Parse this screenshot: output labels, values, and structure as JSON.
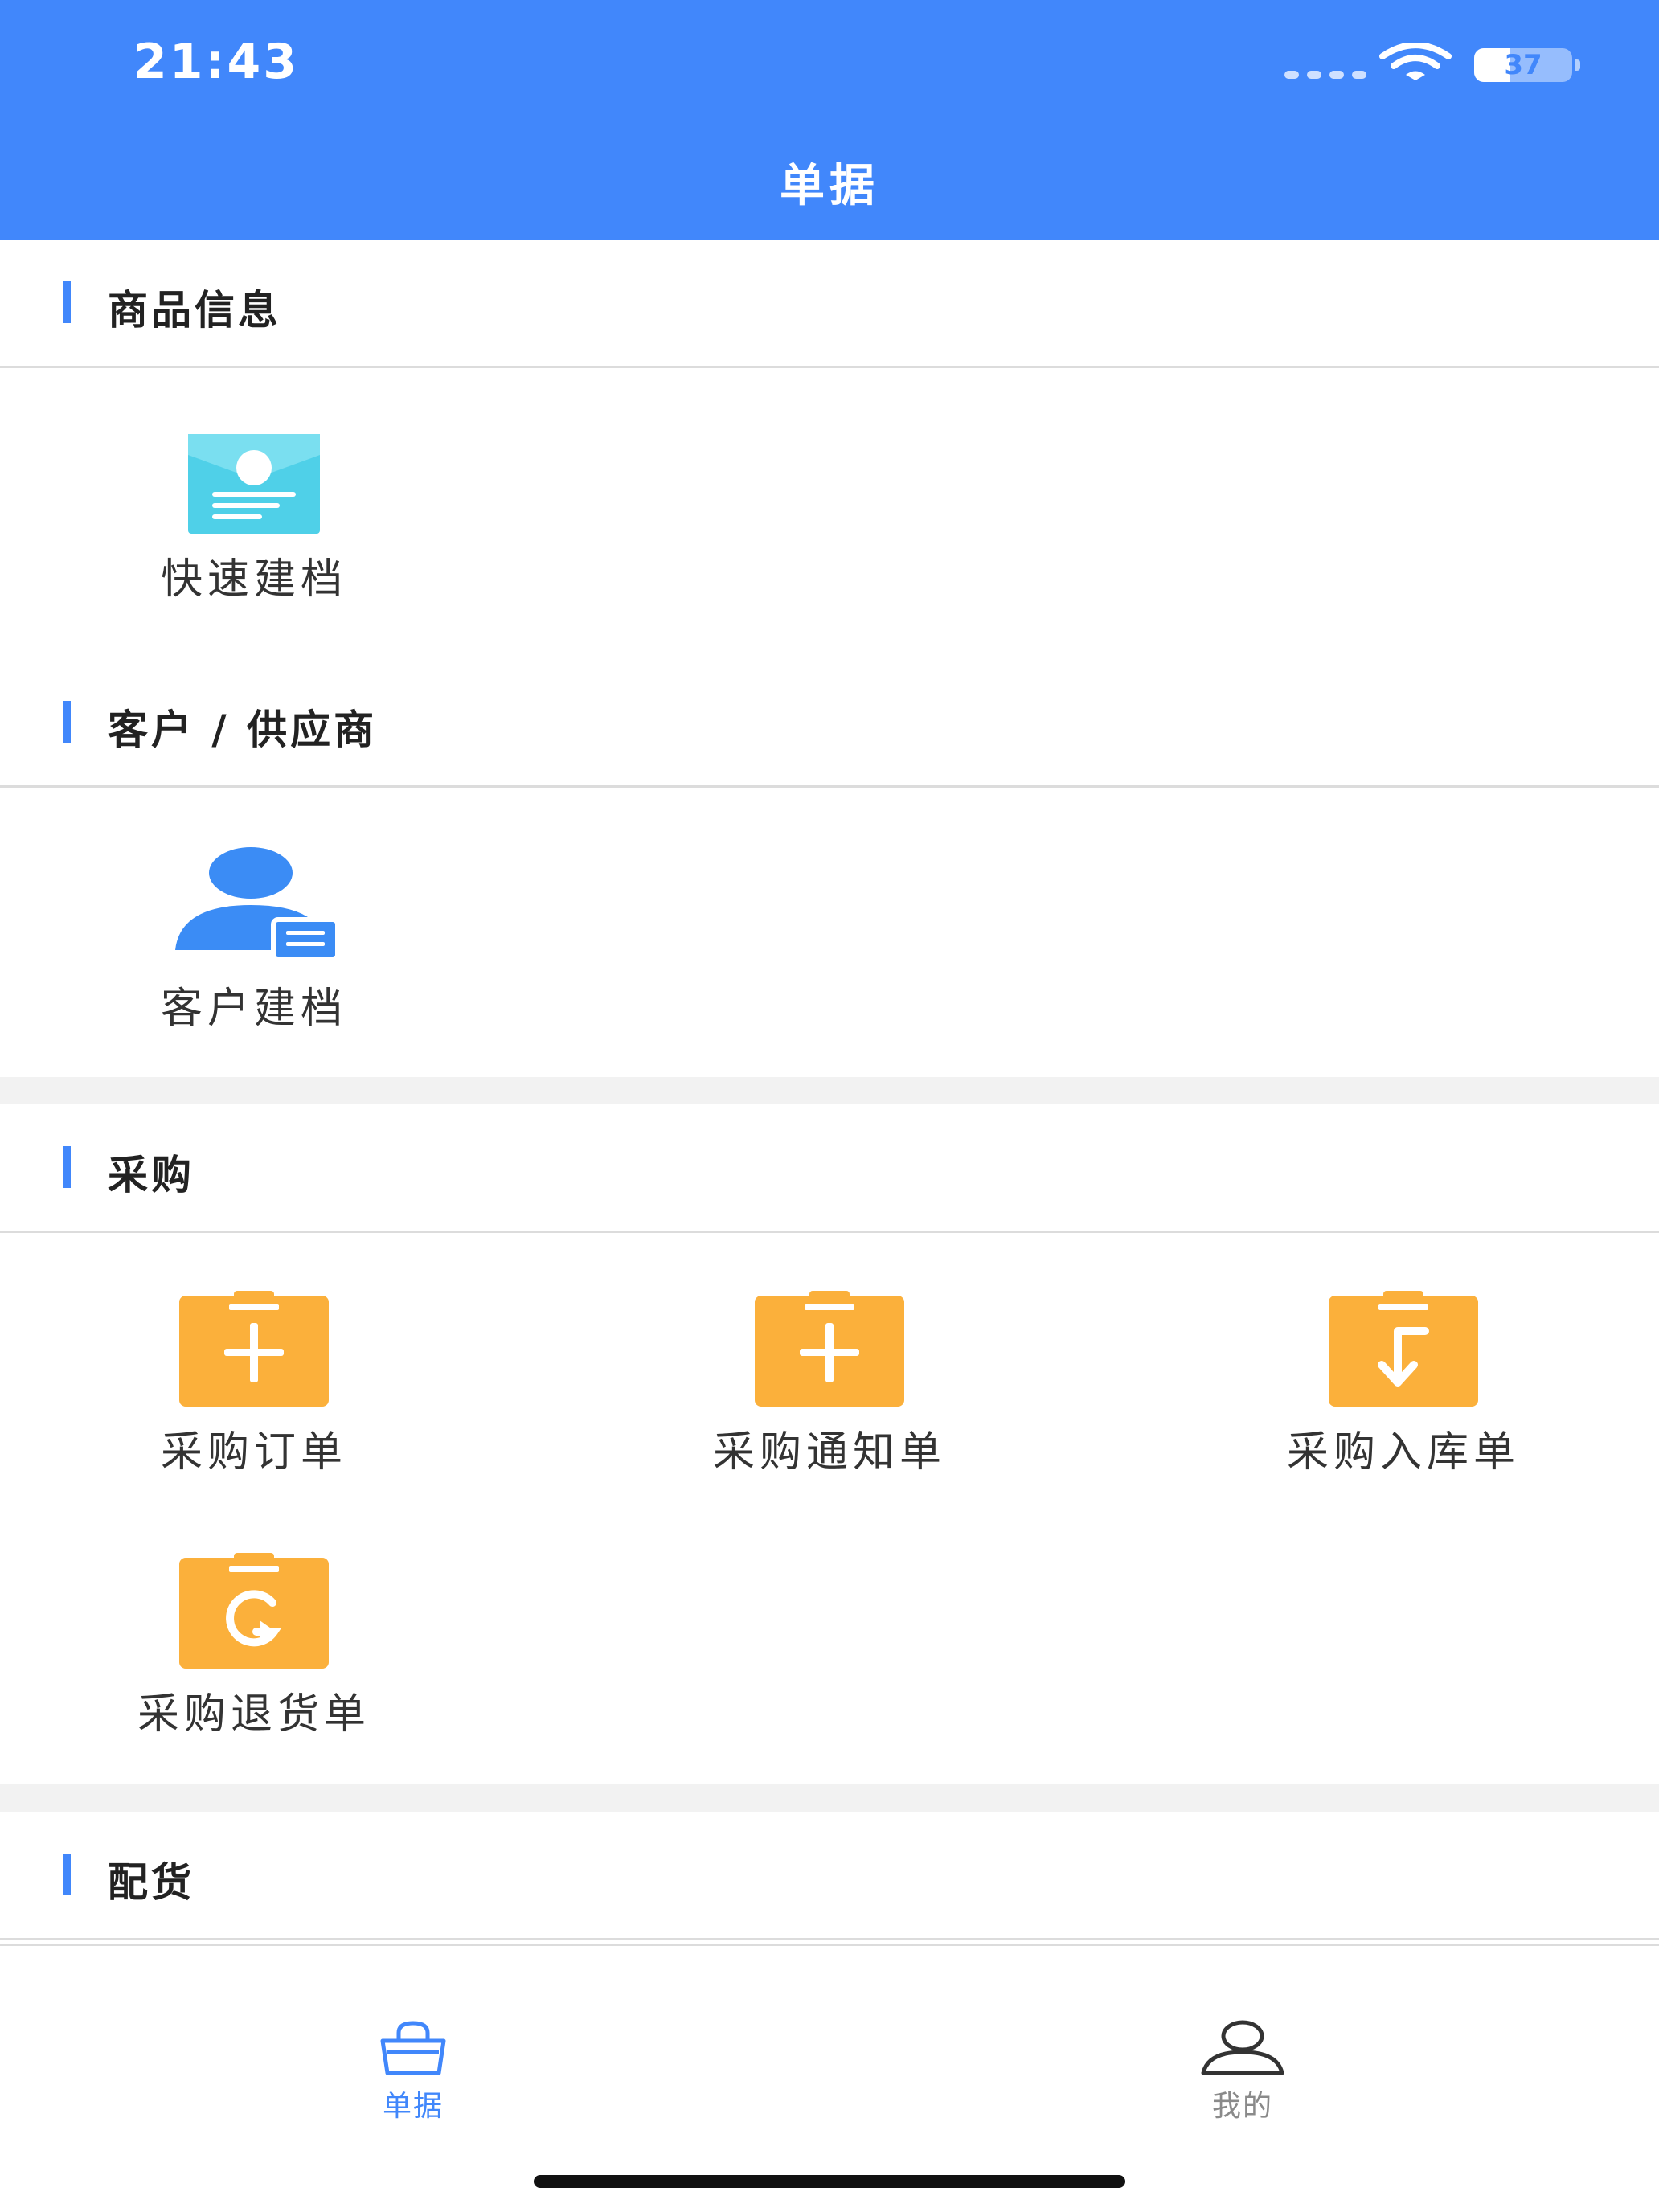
{
  "status_bar": {
    "time": "21:43",
    "battery": "37",
    "battery_level": 0.37
  },
  "header": {
    "title": "单据"
  },
  "sections": [
    {
      "title": "商品信息",
      "items": [
        {
          "label": "快速建档",
          "icon": "archive-card-icon"
        }
      ]
    },
    {
      "title": "客户 / 供应商",
      "items": [
        {
          "label": "客户建档",
          "icon": "customer-card-icon"
        }
      ]
    },
    {
      "title": "采购",
      "items": [
        {
          "label": "采购订单",
          "icon": "clipboard-plus-icon"
        },
        {
          "label": "采购通知单",
          "icon": "clipboard-plus-icon"
        },
        {
          "label": "采购入库单",
          "icon": "clipboard-inbound-icon"
        },
        {
          "label": "采购退货单",
          "icon": "clipboard-return-icon"
        }
      ]
    },
    {
      "title": "配货",
      "items": []
    }
  ],
  "tabbar": {
    "tabs": [
      {
        "label": "单据",
        "icon": "shopping-bag-icon",
        "active": true
      },
      {
        "label": "我的",
        "icon": "person-icon",
        "active": false
      }
    ]
  },
  "colors": {
    "primary": "#4187fb",
    "accent_orange": "#fbb03b",
    "accent_cyan": "#4fd0e8",
    "inactive": "#8a8a8a",
    "divider": "#dcdcdc",
    "gap": "#f2f2f2"
  }
}
